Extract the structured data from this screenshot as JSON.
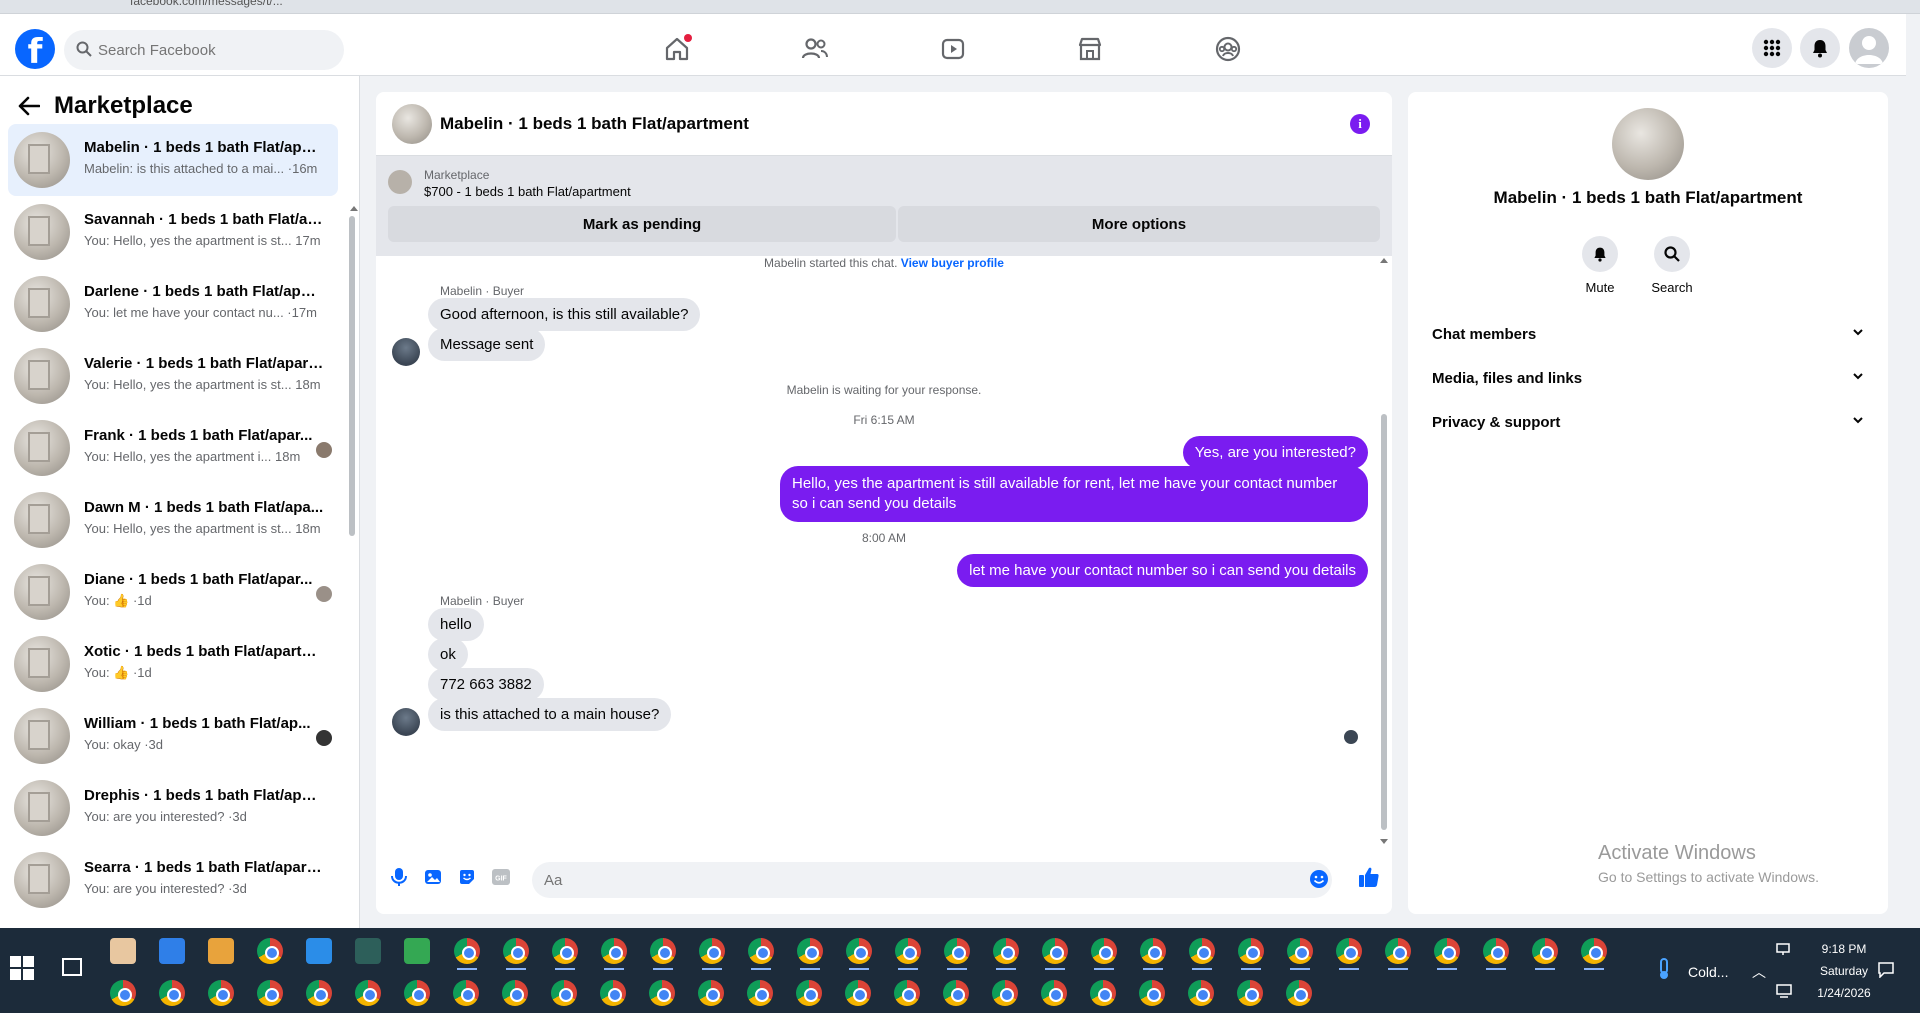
{
  "browser": {
    "url": "facebook.com/messages/t/..."
  },
  "topnav": {
    "logo": "f",
    "search_placeholder": "Search Facebook"
  },
  "sidebar": {
    "title": "Marketplace",
    "conversations": [
      {
        "name": "Mabelin · 1 beds 1 bath Flat/apar...",
        "preview": "Mabelin: is this attached to a mai... ·16m",
        "active": true
      },
      {
        "name": "Savannah · 1 beds 1 bath Flat/ap...",
        "preview": "You: Hello, yes the apartment is st... 17m"
      },
      {
        "name": "Darlene · 1 beds 1 bath Flat/apar...",
        "preview": "You: let me have your contact nu... ·17m"
      },
      {
        "name": "Valerie · 1 beds 1 bath Flat/apart...",
        "preview": "You: Hello, yes the apartment is st... 18m"
      },
      {
        "name": "Frank · 1 beds 1 bath Flat/apar...",
        "preview": "You: Hello, yes the apartment i... 18m"
      },
      {
        "name": "Dawn M · 1 beds 1 bath Flat/apa...",
        "preview": "You: Hello, yes the apartment is st... 18m"
      },
      {
        "name": "Diane · 1 beds 1 bath Flat/apar...",
        "preview": "You: 👍 ·1d"
      },
      {
        "name": "Xotic · 1 beds 1 bath Flat/apartm...",
        "preview": "You: 👍 ·1d"
      },
      {
        "name": "William · 1 beds 1 bath Flat/ap...",
        "preview": "You: okay ·3d"
      },
      {
        "name": "Drephis · 1 beds 1 bath Flat/apar...",
        "preview": "You: are you interested? ·3d"
      },
      {
        "name": "Searra · 1 beds 1 bath Flat/apart...",
        "preview": "You: are you interested? ·3d"
      }
    ]
  },
  "chat": {
    "title": "Mabelin · 1 beds 1 bath Flat/apartment",
    "listing_category": "Marketplace",
    "listing_price": "$700 - 1 beds 1 bath Flat/apartment",
    "mark_pending": "Mark as pending",
    "more_options": "More options",
    "started_text": "Mabelin started this chat.",
    "view_profile": "View buyer profile",
    "sender_label": "Mabelin · Buyer",
    "in1": "Good afternoon, is this still available?",
    "in2": "Message sent",
    "waiting": "Mabelin is waiting for your response.",
    "time1": "Fri 6:15 AM",
    "out1": "Yes, are you interested?",
    "out2": "Hello, yes the apartment is still available for rent, let me have your contact number so i can send you details",
    "time2": "8:00 AM",
    "out3": "let me have your contact number so i can send you details",
    "sender_label2": "Mabelin · Buyer",
    "in3": "hello",
    "in4": "ok",
    "in5": "772 663 3882",
    "in6": "is this attached to a main house?",
    "composer_placeholder": "Aa"
  },
  "right_panel": {
    "title": "Mabelin · 1 beds 1 bath Flat/apartment",
    "mute": "Mute",
    "search": "Search",
    "rows": [
      "Chat members",
      "Media, files and links",
      "Privacy & support"
    ],
    "activate_title": "Activate Windows",
    "activate_sub": "Go to Settings to activate Windows."
  },
  "taskbar": {
    "weather": "Cold...",
    "time": "9:18 PM",
    "day": "Saturday",
    "date": "1/24/2026"
  },
  "colors": {
    "accent": "#7a1cf0",
    "facebook_blue": "#0866ff",
    "notification": "#e41e3f"
  }
}
